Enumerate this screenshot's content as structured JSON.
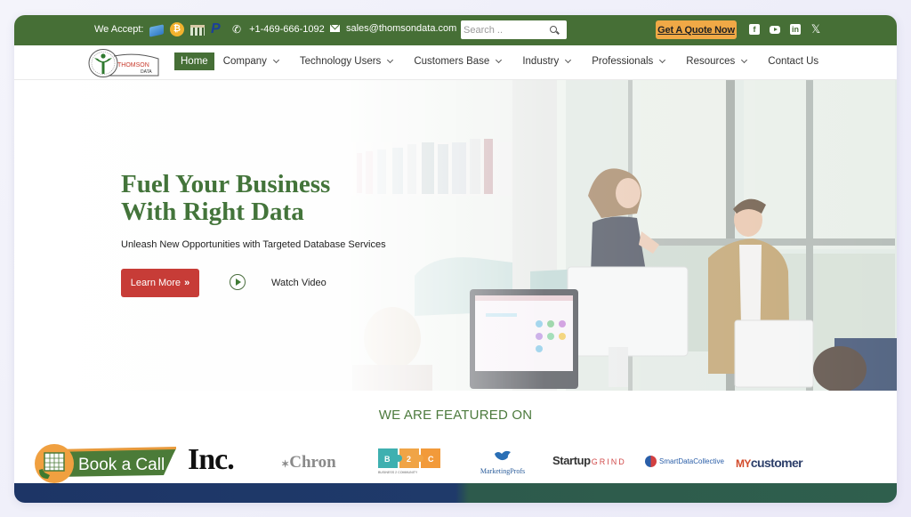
{
  "topbar": {
    "accept_label": "We Accept:",
    "payment_icons": [
      "credit-card-icon",
      "bitcoin-icon",
      "bank-icon",
      "paypal-icon"
    ],
    "phone": "+1-469-666-1092",
    "email": "sales@thomsondata.com",
    "search_placeholder": "Search ..",
    "quote_button": "Get A Quote Now",
    "socials": [
      "facebook-icon",
      "youtube-icon",
      "linkedin-icon",
      "x-icon"
    ],
    "colors": {
      "bar": "#466f36",
      "quote": "#f0a946"
    }
  },
  "logo": {
    "name": "THOMSON",
    "sub": "DATA"
  },
  "nav": {
    "items": [
      {
        "label": "Home",
        "active": true,
        "dropdown": false
      },
      {
        "label": "Company",
        "dropdown": true
      },
      {
        "label": "Technology Users",
        "dropdown": true
      },
      {
        "label": "Customers Base",
        "dropdown": true
      },
      {
        "label": "Industry",
        "dropdown": true
      },
      {
        "label": "Professionals",
        "dropdown": true
      },
      {
        "label": "Resources",
        "dropdown": true
      },
      {
        "label": "Contact Us",
        "dropdown": false
      }
    ]
  },
  "hero": {
    "title_line1": "Fuel Your Business",
    "title_line2": "With Right Data",
    "subtitle": "Unleash New Opportunities with Targeted Database Services",
    "learn_more": "Learn More",
    "learn_more_icon": "»",
    "watch_video": "Watch Video",
    "colors": {
      "title": "#43743a",
      "button": "#c73c37"
    }
  },
  "featured": {
    "title": "WE ARE FEATURED ON",
    "book_call": "Book a Call",
    "logos": {
      "inc": "Inc.",
      "chron": "Chron",
      "b2c_letters": [
        "B",
        "2",
        "C"
      ],
      "b2c_caption": "BUSINESS 2 COMMUNITY",
      "marketingprofs": "MarketingProfs",
      "startup": "Startup",
      "grind": "GRIND",
      "smartdata": "SmartDataCollective",
      "my": "MY",
      "customer": "customer"
    }
  }
}
